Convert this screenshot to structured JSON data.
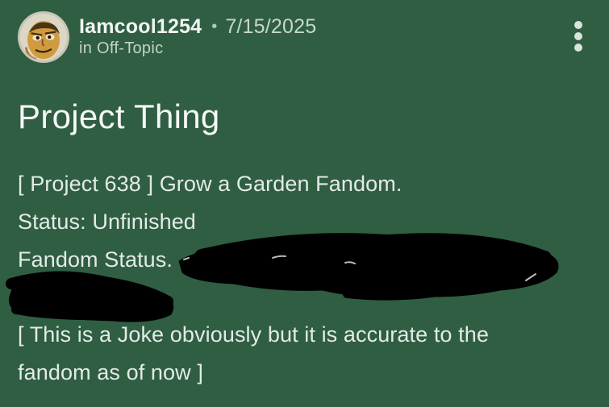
{
  "post": {
    "author": "Iamcool1254",
    "separator": "•",
    "date": "7/15/2025",
    "category": "in Off-Topic",
    "title": "Project Thing",
    "body": {
      "line1": "[ Project 638 ] Grow a Garden Fandom.",
      "line2": "Status: Unfinished",
      "line3": "Fandom Status.",
      "line4": "[ This is a Joke obviously but it is accurate to the",
      "line5": "fandom as of now ]"
    }
  },
  "icons": {
    "avatar": "avatar-image",
    "menu": "more-options-vertical-icon",
    "redaction": "scribble-redaction"
  },
  "colors": {
    "background": "#2f5e43",
    "text": "#e3ebe5",
    "redaction": "#000000"
  }
}
